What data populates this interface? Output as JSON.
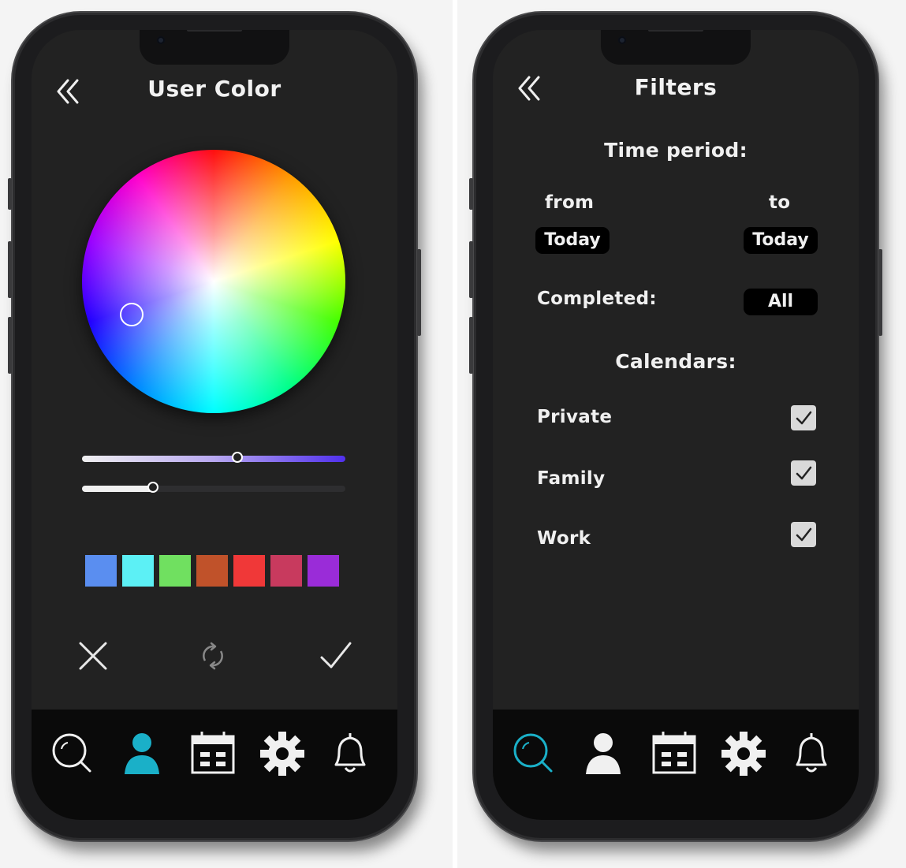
{
  "colors": {
    "screen_bg": "#222222",
    "tabbar_bg": "#0a0a0a",
    "accent_cyan": "#1ab0c8",
    "text": "#f0f0f0"
  },
  "left_screen": {
    "title": "User Color",
    "back_icon": "double-chevron-left-icon",
    "color_wheel": {
      "selected_marker": "circle"
    },
    "sliders": [
      {
        "name": "hue-saturation",
        "value_percent": 59
      },
      {
        "name": "brightness",
        "value_percent": 27
      }
    ],
    "swatches": [
      "#5a8ef0",
      "#5cf0f5",
      "#70e060",
      "#c0522a",
      "#f03838",
      "#c83a5e",
      "#9a2cd8"
    ],
    "actions": [
      "close-icon",
      "refresh-icon",
      "check-icon"
    ],
    "active_tab": "profile"
  },
  "right_screen": {
    "title": "Filters",
    "time_period_heading": "Time period:",
    "from_label": "from",
    "to_label": "to",
    "from_value": "Today",
    "to_value": "Today",
    "completed_label": "Completed:",
    "completed_value": "All",
    "calendars_heading": "Calendars:",
    "calendars": [
      {
        "label": "Private",
        "checked": true
      },
      {
        "label": "Family",
        "checked": true
      },
      {
        "label": "Work",
        "checked": true
      }
    ],
    "active_tab": "search"
  },
  "tabbar_icons": [
    "search-icon",
    "user-icon",
    "calendar-icon",
    "gear-icon",
    "bell-icon"
  ]
}
